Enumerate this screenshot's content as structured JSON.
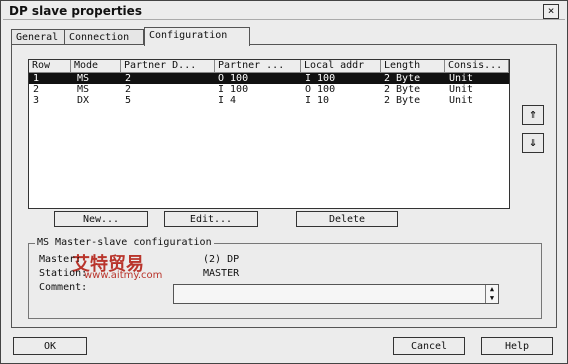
{
  "window": {
    "title": "DP slave properties",
    "close_glyph": "×"
  },
  "tabs": [
    {
      "label": "General"
    },
    {
      "label": "Connection"
    },
    {
      "label": "Configuration"
    }
  ],
  "table": {
    "headers": [
      "Row",
      "Mode",
      "Partner D...",
      "Partner ...",
      "Local addr",
      "Length",
      "Consis..."
    ],
    "rows": [
      [
        "1",
        "MS",
        "2",
        "O 100",
        "I 100",
        "2 Byte",
        "Unit"
      ],
      [
        "2",
        "MS",
        "2",
        "I 100",
        "O 100",
        "2 Byte",
        "Unit"
      ],
      [
        "3",
        "DX",
        "5",
        "I 4",
        "I 10",
        "2 Byte",
        "Unit"
      ]
    ],
    "selected_row": 0
  },
  "side": {
    "up_glyph": "⇑",
    "down_glyph": "⇓"
  },
  "buttons": {
    "new": "New...",
    "edit": "Edit...",
    "delete": "Delete"
  },
  "group": {
    "title": "MS Master-slave configuration",
    "master_label": "Master:",
    "master_value": "(2) DP",
    "station_label": "Station:",
    "station_value": "MASTER",
    "comment_label": "Comment:"
  },
  "footer": {
    "ok": "OK",
    "cancel": "Cancel",
    "help": "Help"
  },
  "watermark": {
    "brand": "艾特贸易",
    "url": "www.aitmy.com"
  }
}
